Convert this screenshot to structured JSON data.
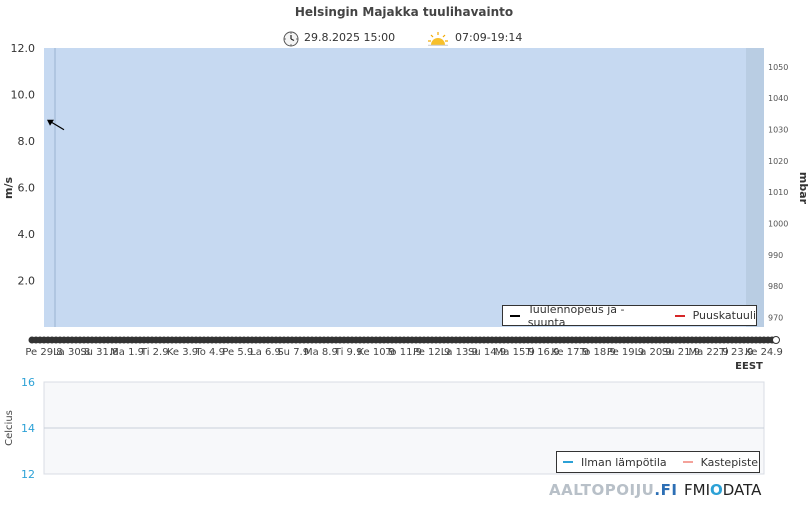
{
  "header": {
    "title": "Helsingin Majakka tuulihavainto",
    "observation_time": "29.8.2025 15:00",
    "sun_times": "07:09-19:14"
  },
  "colors": {
    "wind_bg": "#c6d9f1",
    "night_band": "#b9cde3",
    "wind_line": "#000000",
    "gust_line": "#d62728",
    "temp_line": "#2ca1d6",
    "dew_line": "#f4a29a",
    "temp_axis": "#2ca1d6",
    "brand_grey": "#b8c0c8",
    "brand_blue": "#2d6fb5"
  },
  "chart_data": [
    {
      "type": "line",
      "title": "Helsingin Majakka tuulihavainto",
      "ylabel": "m/s",
      "y2label": "mbar",
      "ylim": [
        0,
        12
      ],
      "yticks": [
        "2.0",
        "4.0",
        "6.0",
        "8.0",
        "10.0",
        "12.0"
      ],
      "y2lim": [
        967,
        1056
      ],
      "y2ticks": [
        "970",
        "980",
        "990",
        "1000",
        "1010",
        "1020",
        "1030",
        "1040",
        "1050"
      ],
      "x_ticks": [
        "Pe 29.8",
        "La 30.8",
        "Su 31.8",
        "Ma 1.9",
        "Ti 2.9",
        "Ke 3.9",
        "To 4.9",
        "Pe 5.9",
        "La 6.9",
        "Su 7.9",
        "Ma 8.9",
        "Ti 9.9",
        "Ke 10.9",
        "To 11.9",
        "Pe 12.9",
        "La 13.9",
        "Su 14.9",
        "Ma 15.9",
        "Ti 16.9",
        "Ke 17.9",
        "To 18.9",
        "Pe 19.9",
        "La 20.9",
        "Su 21.9",
        "Ma 22.9",
        "Ti 23.9",
        "Ke 24.9"
      ],
      "x_unit": "EEST",
      "series": [
        {
          "name": "Tuulennopeus ja -suunta",
          "values": [],
          "color": "#000000"
        },
        {
          "name": "Puuskatuuli",
          "values": [],
          "color": "#d62728"
        }
      ],
      "wind_arrow": {
        "x_label": "Pe 29.8",
        "speed": 8.7,
        "direction": "from northwest"
      },
      "legend_position": "bottom-right",
      "grid": false
    },
    {
      "type": "line",
      "ylabel": "Celcius",
      "ylim": [
        12,
        16
      ],
      "yticks": [
        "12",
        "14",
        "16"
      ],
      "series": [
        {
          "name": "Ilman lämpötila",
          "values": [],
          "color": "#2ca1d6"
        },
        {
          "name": "Kastepiste",
          "values": [],
          "color": "#f4a29a"
        }
      ],
      "legend_position": "bottom-right",
      "grid": true
    }
  ],
  "branding": {
    "aaltopoiju": "AALTOPOIJU",
    "aaltopoiju_suffix": ".FI",
    "fmi": "FMI",
    "data_o": "O",
    "data_rest": "DATA",
    "data_d": "D"
  }
}
